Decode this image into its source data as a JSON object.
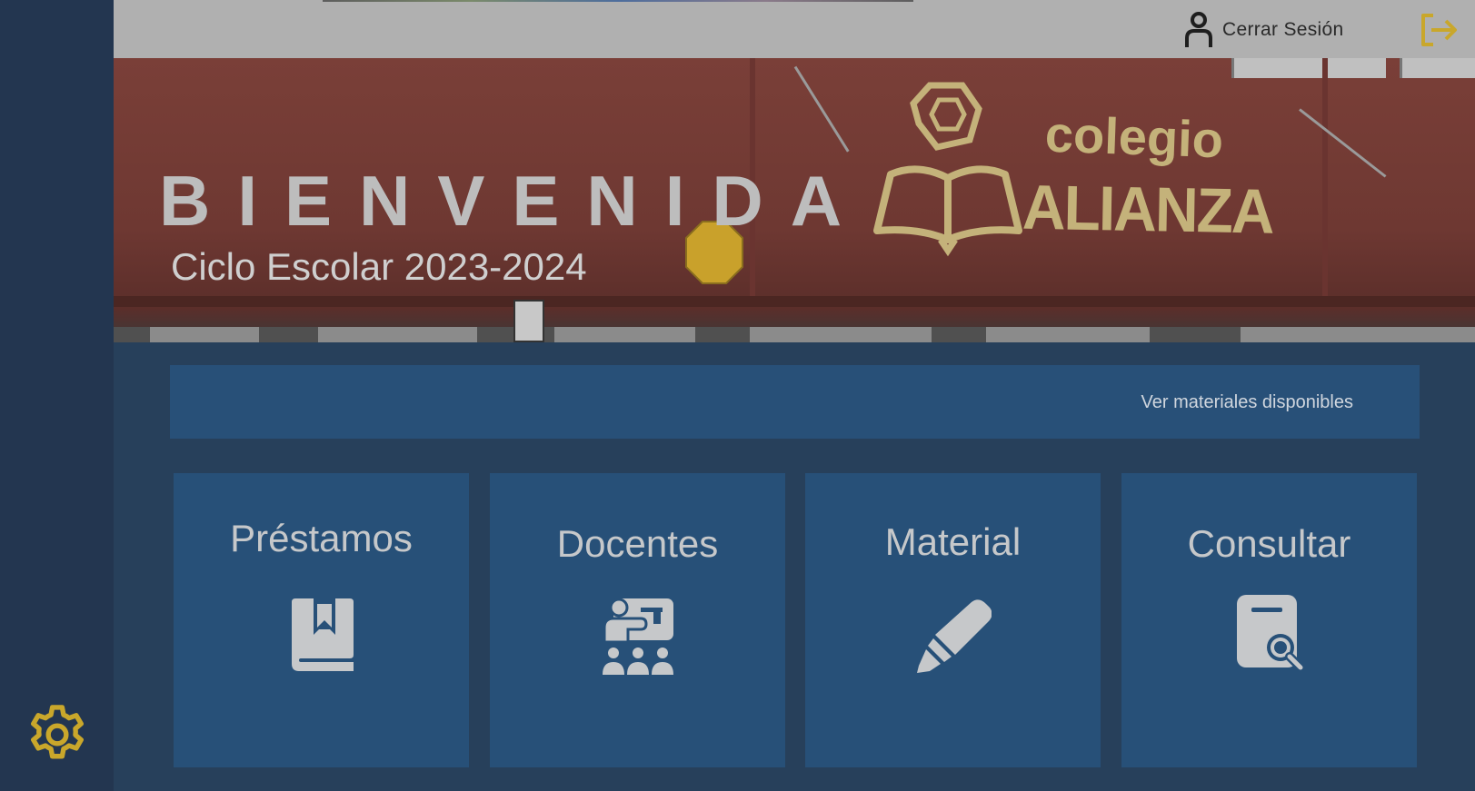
{
  "header": {
    "logout_label": "Cerrar Sesión"
  },
  "hero": {
    "title": "BIENVENIDA",
    "subtitle": "Ciclo Escolar 2023-2024",
    "school_name_line1": "colegio",
    "school_name_line2": "ALIANZA"
  },
  "banner": {
    "link_label": "Ver materiales disponibles"
  },
  "cards": [
    {
      "label": "Préstamos",
      "icon": "book-icon"
    },
    {
      "label": "Docentes",
      "icon": "teacher-class-icon"
    },
    {
      "label": "Material",
      "icon": "highlighter-icon"
    },
    {
      "label": "Consultar",
      "icon": "document-search-icon"
    }
  ],
  "colors": {
    "sidebar": "#233650",
    "main_background": "#27405b",
    "card": "#275078",
    "accent_gold": "#c9a72b",
    "topbar": "#b0b0b0"
  }
}
